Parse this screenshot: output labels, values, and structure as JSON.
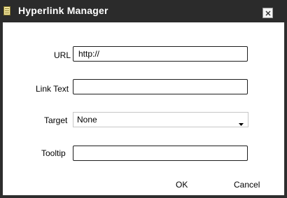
{
  "window": {
    "title": "Hyperlink Manager",
    "icon": "app-icon",
    "close_icon": "close-icon"
  },
  "form": {
    "url_label": "URL",
    "url_value": "http://",
    "link_text_label": "Link Text",
    "link_text_value": "",
    "target_label": "Target",
    "target_value": "None",
    "tooltip_label": "Tooltip",
    "tooltip_value": ""
  },
  "buttons": {
    "ok_label": "OK",
    "cancel_label": "Cancel"
  },
  "colors": {
    "titlebar": "#2b2b2b",
    "content_background": "#ffffff",
    "field_border": "#1e1e1e"
  }
}
